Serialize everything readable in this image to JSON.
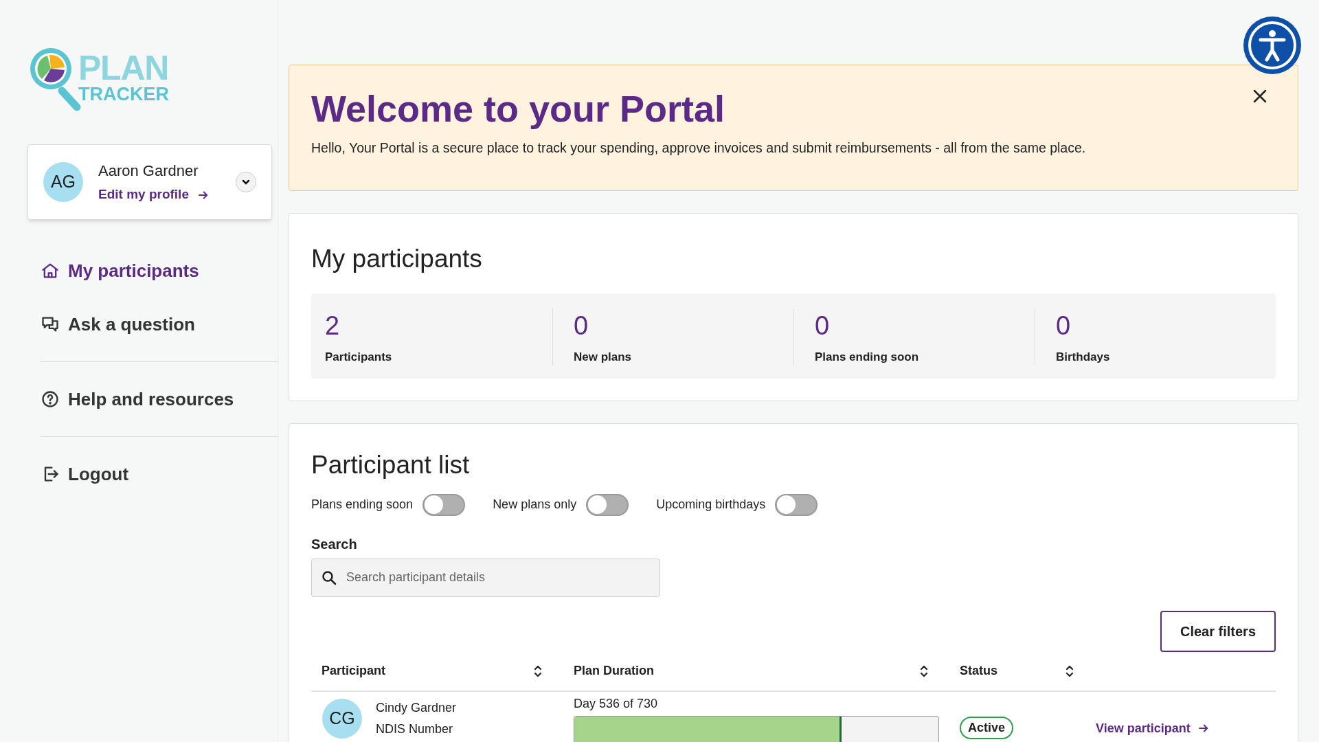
{
  "logo": {
    "line_1": "PLAN",
    "line_2": "TRACKER"
  },
  "profile": {
    "initials": "AG",
    "name": "Aaron Gardner",
    "link": "Edit my profile"
  },
  "nav_groups": [
    {
      "items": [
        {
          "kind": "home",
          "label": "My participants",
          "selected": true
        },
        {
          "kind": "chat",
          "label": "Ask a question",
          "selected": false
        }
      ]
    },
    {
      "items": [
        {
          "kind": "help",
          "label": "Help and resources",
          "selected": false
        }
      ]
    },
    {
      "items": [
        {
          "kind": "logout",
          "label": "Logout",
          "selected": false
        }
      ]
    }
  ],
  "banner": {
    "title": "Welcome to your Portal",
    "text": "Hello, Your Portal is a secure place to track your spending, approve invoices and submit reimbursements - all from the same place."
  },
  "summary": {
    "title": "My participants",
    "stats": [
      {
        "value": "2",
        "label": "Participants"
      },
      {
        "value": "0",
        "label": "New plans"
      },
      {
        "value": "0",
        "label": "Plans ending soon"
      },
      {
        "value": "0",
        "label": "Birthdays"
      }
    ]
  },
  "participant_list": {
    "title": "Participant list",
    "filters": [
      {
        "label": "Plans ending soon",
        "on": false
      },
      {
        "label": "New plans only",
        "on": false
      },
      {
        "label": "Upcoming birthdays",
        "on": false
      }
    ],
    "search": {
      "label": "Search",
      "placeholder": "Search participant details"
    },
    "clear_button": "Clear filters",
    "columns": [
      "Participant",
      "Plan Duration",
      "Status"
    ],
    "rows": [
      {
        "initials": "CG",
        "name": "Cindy Gardner",
        "detail": "NDIS Number",
        "duration": "Day 536 of 730",
        "level": 0.734,
        "status": "Active",
        "link": "View participant"
      }
    ]
  }
}
